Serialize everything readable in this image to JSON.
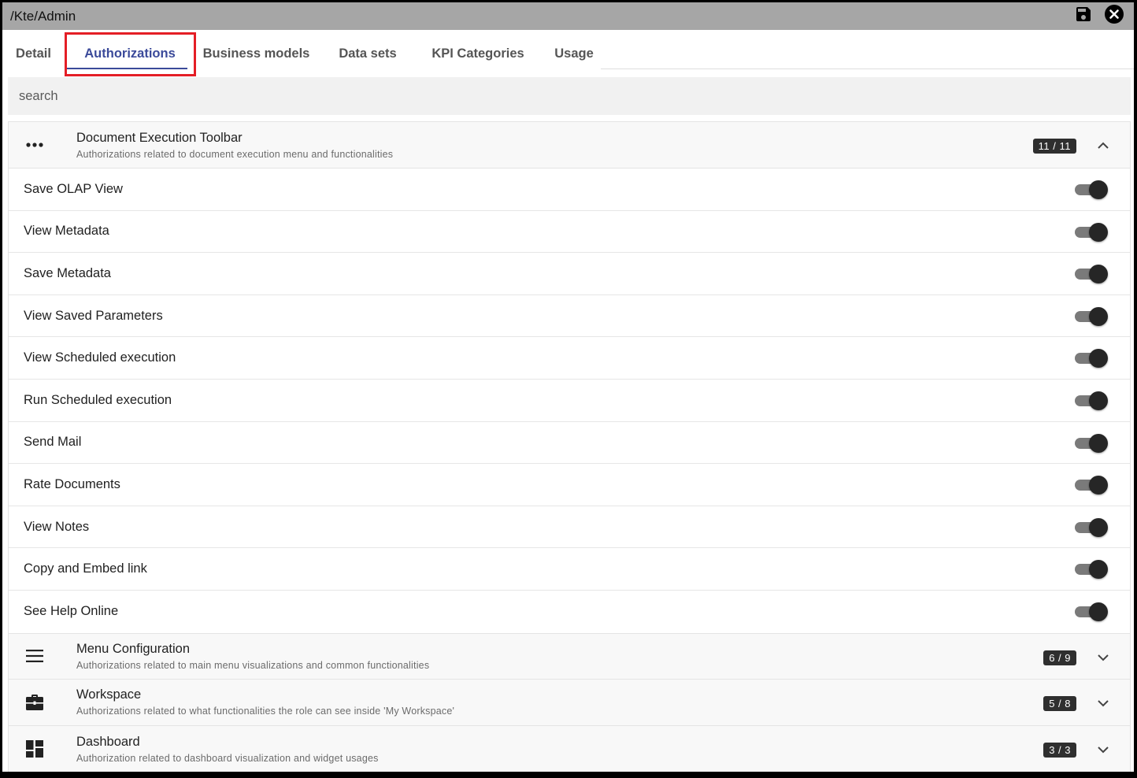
{
  "window": {
    "title": "/Kte/Admin"
  },
  "toolbar": {
    "save_icon": "save-icon",
    "close_icon": "close-icon"
  },
  "tabs": [
    {
      "label": "Detail",
      "active": false
    },
    {
      "label": "Authorizations",
      "active": true
    },
    {
      "label": "Business models",
      "active": false
    },
    {
      "label": "Data sets",
      "active": false
    },
    {
      "label": "KPI Categories",
      "active": false
    },
    {
      "label": "Usage",
      "active": false
    }
  ],
  "search": {
    "placeholder": "search",
    "value": ""
  },
  "groups": [
    {
      "icon": "more-horizontal-icon",
      "title": "Document Execution Toolbar",
      "description": "Authorizations related to document execution menu and functionalities",
      "badge": "11 / 11",
      "expanded": true,
      "items": [
        {
          "label": "Save OLAP View",
          "enabled": true
        },
        {
          "label": "View Metadata",
          "enabled": true
        },
        {
          "label": "Save Metadata",
          "enabled": true
        },
        {
          "label": "View Saved Parameters",
          "enabled": true
        },
        {
          "label": "View Scheduled execution",
          "enabled": true
        },
        {
          "label": "Run Scheduled execution",
          "enabled": true
        },
        {
          "label": "Send Mail",
          "enabled": true
        },
        {
          "label": "Rate Documents",
          "enabled": true
        },
        {
          "label": "View Notes",
          "enabled": true
        },
        {
          "label": "Copy and Embed link",
          "enabled": true
        },
        {
          "label": "See Help Online",
          "enabled": true
        }
      ]
    },
    {
      "icon": "menu-icon",
      "title": "Menu Configuration",
      "description": "Authorizations related to main menu visualizations and common functionalities",
      "badge": "6 / 9",
      "expanded": false
    },
    {
      "icon": "briefcase-icon",
      "title": "Workspace",
      "description": "Authorizations related to what functionalities the role can see inside 'My Workspace'",
      "badge": "5 / 8",
      "expanded": false
    },
    {
      "icon": "dashboard-icon",
      "title": "Dashboard",
      "description": "Authorization related to dashboard visualization and widget usages",
      "badge": "3 / 3",
      "expanded": false
    }
  ],
  "colors": {
    "accent": "#3b4a9a",
    "highlight": "#e41e26",
    "titlebar": "#a6a6a6"
  }
}
